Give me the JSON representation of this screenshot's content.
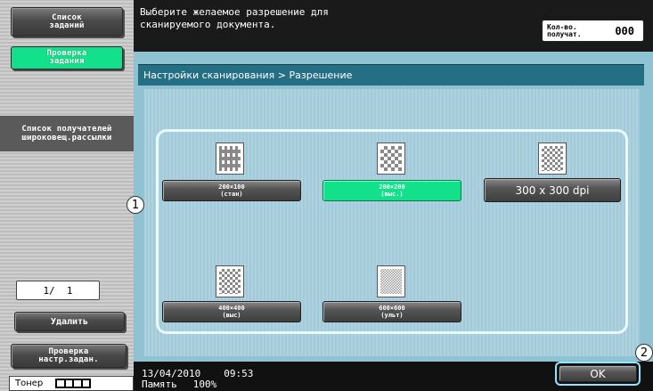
{
  "left_panel": {
    "job_list_label": "Список\nзаданий",
    "job_check_label": "Проверка\nзадания",
    "destination_list_label": "Список получателей\nшироковещ.рассылки",
    "page_indicator": "1/  1",
    "delete_label": "Удалить",
    "check_settings_label": "Проверка\nнастр.задан.",
    "toner_label": "Тонер",
    "toner_level": "4/4"
  },
  "header": {
    "message_line1": "Выберите желаемое разрешение для",
    "message_line2": "сканируемого документа.",
    "copies_label": "Кол-во.\nполучат.",
    "copies_value": "000"
  },
  "breadcrumb": "Настройки сканирования > Разрешение",
  "resolutions": [
    {
      "label": "200×100\n(стан)",
      "icon": "coarse-pattern-icon",
      "selected": false
    },
    {
      "label": "200×200\n(выс.)",
      "icon": "checker-pattern-icon",
      "selected": true
    },
    {
      "label": "300 x 300 dpi",
      "icon": "checker-pattern-icon",
      "selected": false
    },
    {
      "label": "400×400\n(выс)",
      "icon": "checker-pattern-icon",
      "selected": false
    },
    {
      "label": "600×600\n(ульт)",
      "icon": "fine-pattern-icon",
      "selected": false
    }
  ],
  "callouts": {
    "c1": "1",
    "c2": "2"
  },
  "status": {
    "date": "13/04/2010",
    "time": "09:53",
    "memory_label": "Память",
    "memory_value": "100%"
  },
  "ok_label": "OK",
  "colors": {
    "selected": "#12e08a",
    "panel": "#8fc3d3",
    "breadcrumb": "#246f84",
    "highlight": "#e8fbff"
  }
}
